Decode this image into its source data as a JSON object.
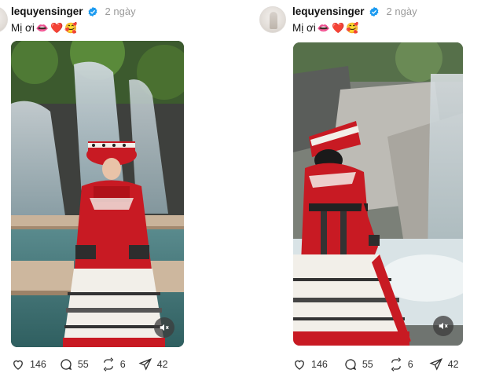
{
  "posts": [
    {
      "username": "lequyensinger",
      "time": "2 ngày",
      "caption_text": "Mị ơi",
      "caption_emojis": [
        "👄",
        "❤️",
        "🥰"
      ],
      "likes": "146",
      "comments": "55",
      "reposts": "6",
      "shares": "42"
    },
    {
      "username": "lequyensinger",
      "time": "2 ngày",
      "caption_text": "Mị ơi",
      "caption_emojis": [
        "👄",
        "❤️",
        "🥰"
      ],
      "likes": "146",
      "comments": "55",
      "reposts": "6",
      "shares": "42"
    }
  ],
  "icons": {
    "verified": "verified-badge-icon",
    "like": "heart-icon",
    "comment": "comment-bubble-icon",
    "repost": "repost-icon",
    "share": "send-icon",
    "mute": "speaker-muted-icon"
  },
  "colors": {
    "verified": "#1d9bf0",
    "dress_red": "#c81a23",
    "skirt_white": "#f2efe9"
  }
}
